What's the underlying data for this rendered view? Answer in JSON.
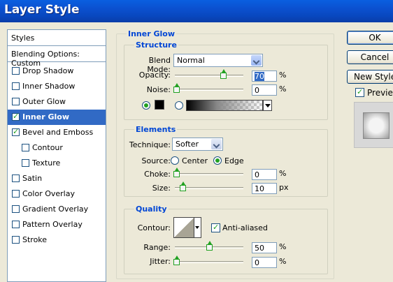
{
  "window": {
    "title": "Layer Style"
  },
  "styles_list": {
    "header": "Styles",
    "blending": "Blending Options: Custom",
    "items": [
      {
        "label": "Drop Shadow",
        "checked": false
      },
      {
        "label": "Inner Shadow",
        "checked": false
      },
      {
        "label": "Outer Glow",
        "checked": false
      },
      {
        "label": "Inner Glow",
        "checked": true,
        "selected": true
      },
      {
        "label": "Bevel and Emboss",
        "checked": true
      },
      {
        "label": "Contour",
        "checked": false,
        "indent": true
      },
      {
        "label": "Texture",
        "checked": false,
        "indent": true
      },
      {
        "label": "Satin",
        "checked": false
      },
      {
        "label": "Color Overlay",
        "checked": false
      },
      {
        "label": "Gradient Overlay",
        "checked": false
      },
      {
        "label": "Pattern Overlay",
        "checked": false
      },
      {
        "label": "Stroke",
        "checked": false
      }
    ]
  },
  "inner_glow": {
    "title": "Inner Glow",
    "structure": {
      "title": "Structure",
      "blend_mode_label": "Blend Mode:",
      "blend_mode": "Normal",
      "opacity_label": "Opacity:",
      "opacity": "70",
      "noise_label": "Noise:",
      "noise": "0",
      "unit": "%",
      "color_mode": "solid"
    },
    "elements": {
      "title": "Elements",
      "technique_label": "Technique:",
      "technique": "Softer",
      "source_label": "Source:",
      "source_center": "Center",
      "source_edge": "Edge",
      "source_selected": "Edge",
      "choke_label": "Choke:",
      "choke": "0",
      "choke_unit": "%",
      "size_label": "Size:",
      "size": "10",
      "size_unit": "px"
    },
    "quality": {
      "title": "Quality",
      "contour_label": "Contour:",
      "anti_aliased_label": "Anti-aliased",
      "anti_aliased": true,
      "range_label": "Range:",
      "range": "50",
      "range_unit": "%",
      "jitter_label": "Jitter:",
      "jitter": "0",
      "jitter_unit": "%"
    }
  },
  "buttons": {
    "ok": "OK",
    "cancel": "Cancel",
    "new_style": "New Style",
    "preview_label": "Preview",
    "preview_checked": true
  },
  "colors": {
    "accent": "#0046d5",
    "titlebar": "#0a50cf",
    "check": "#21a121",
    "selection": "#316ac5"
  }
}
